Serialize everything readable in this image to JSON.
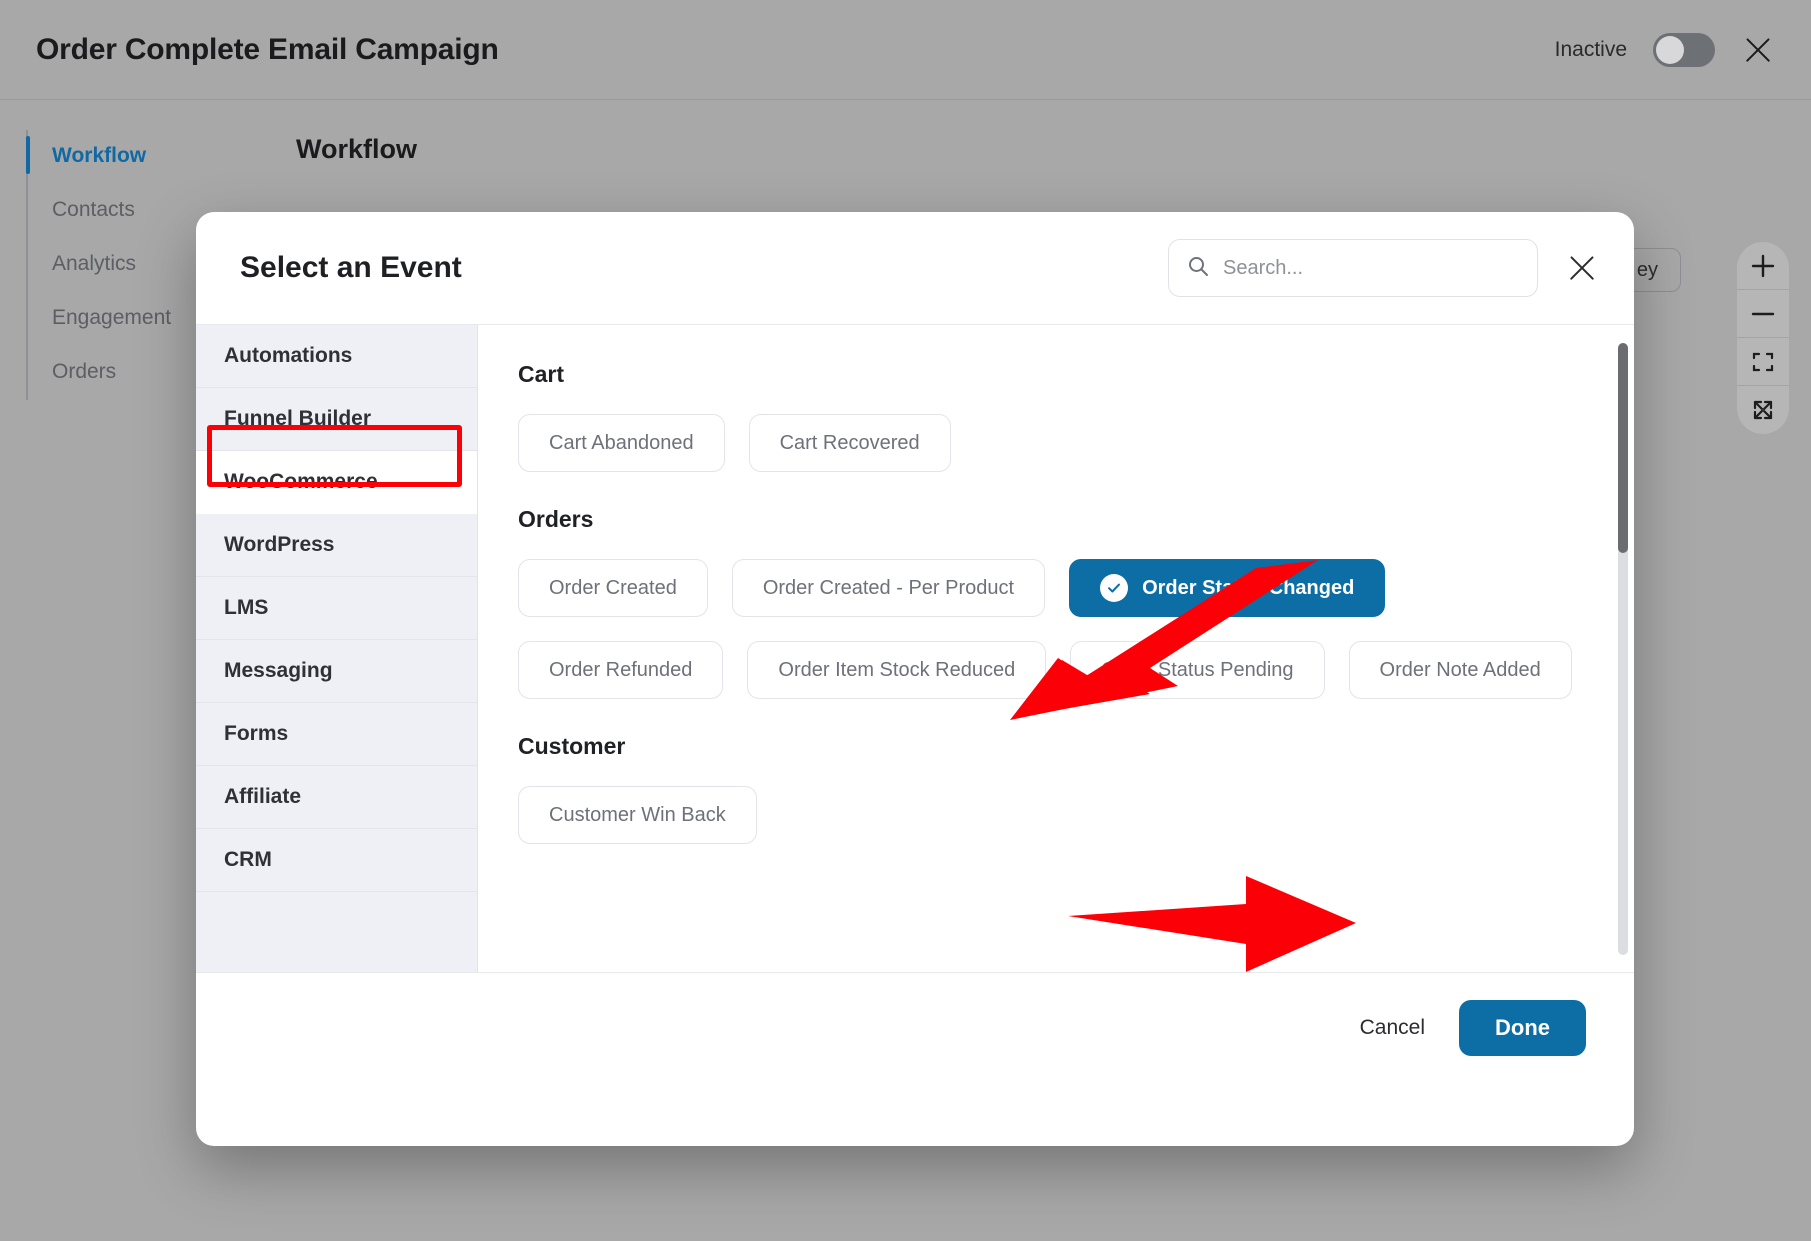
{
  "header": {
    "title": "Order Complete Email Campaign",
    "status_label": "Inactive",
    "toggle_state": "off",
    "close_icon": "close-icon"
  },
  "sidebar": {
    "items": [
      {
        "label": "Workflow",
        "active": true
      },
      {
        "label": "Contacts",
        "active": false
      },
      {
        "label": "Analytics",
        "active": false
      },
      {
        "label": "Engagement",
        "active": false
      },
      {
        "label": "Orders",
        "active": false
      }
    ]
  },
  "canvas": {
    "heading": "Workflow",
    "occluded_pill_label": "ey",
    "zoom_controls": [
      {
        "icon": "plus-icon",
        "name": "zoom-in"
      },
      {
        "icon": "minus-icon",
        "name": "zoom-out"
      },
      {
        "icon": "fit-screen-icon",
        "name": "fit-to-screen"
      },
      {
        "icon": "expand-icon",
        "name": "expand-fullscreen"
      }
    ]
  },
  "modal": {
    "title": "Select an Event",
    "search": {
      "placeholder": "Search...",
      "value": "",
      "icon": "search-icon"
    },
    "close_icon": "close-icon",
    "categories": [
      {
        "label": "Automations",
        "selected": false
      },
      {
        "label": "Funnel Builder",
        "selected": false
      },
      {
        "label": "WooCommerce",
        "selected": true
      },
      {
        "label": "WordPress",
        "selected": false
      },
      {
        "label": "LMS",
        "selected": false
      },
      {
        "label": "Messaging",
        "selected": false
      },
      {
        "label": "Forms",
        "selected": false
      },
      {
        "label": "Affiliate",
        "selected": false
      },
      {
        "label": "CRM",
        "selected": false
      }
    ],
    "groups": [
      {
        "title": "Cart",
        "events": [
          {
            "label": "Cart Abandoned",
            "selected": false
          },
          {
            "label": "Cart Recovered",
            "selected": false
          }
        ]
      },
      {
        "title": "Orders",
        "events": [
          {
            "label": "Order Created",
            "selected": false
          },
          {
            "label": "Order Created - Per Product",
            "selected": false
          },
          {
            "label": "Order Status Changed",
            "selected": true
          },
          {
            "label": "Order Refunded",
            "selected": false
          },
          {
            "label": "Order Item Stock Reduced",
            "selected": false
          },
          {
            "label": "Order Status Pending",
            "selected": false
          },
          {
            "label": "Order Note Added",
            "selected": false
          }
        ]
      },
      {
        "title": "Customer",
        "events": [
          {
            "label": "Customer Win Back",
            "selected": false
          }
        ]
      }
    ],
    "footer": {
      "cancel_label": "Cancel",
      "done_label": "Done"
    }
  },
  "annotations": {
    "highlight_color": "#fb0007",
    "box_target": "WooCommerce",
    "arrow_targets": [
      "Order Status Changed",
      "Done"
    ]
  },
  "colors": {
    "accent": "#0c6ea4",
    "nav_active": "#1169a4",
    "annotation_red": "#fb0007",
    "page_bg": "#a8a8a8"
  }
}
